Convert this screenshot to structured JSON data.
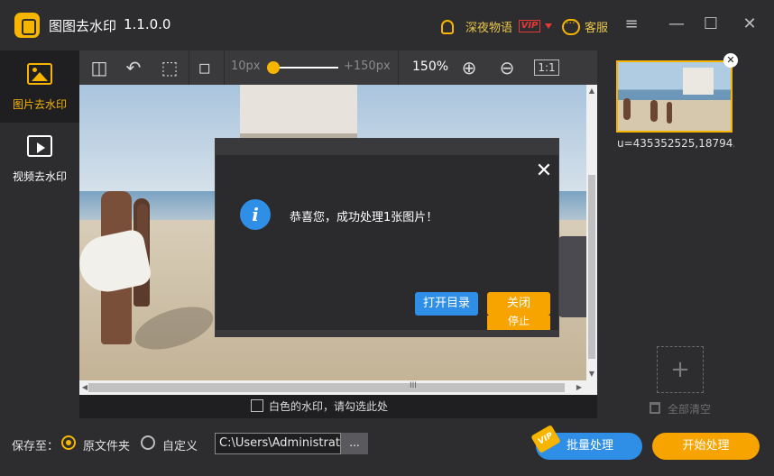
{
  "titlebar": {
    "app_name": "图图去水印",
    "version": "1.1.0.0",
    "user_name": "深夜物语",
    "vip_badge": "VIP",
    "service_label": "客服",
    "menu_icon": "≡",
    "minimize_icon": "—",
    "maximize_icon": "☐",
    "close_icon": "✕"
  },
  "sidebar": {
    "items": [
      {
        "label": "图片去水印",
        "icon": "image-icon",
        "active": true
      },
      {
        "label": "视频去水印",
        "icon": "video-icon",
        "active": false
      }
    ]
  },
  "toolbar": {
    "tools": [
      {
        "icon": "split-view-icon",
        "glyph": "◫"
      },
      {
        "icon": "undo-icon",
        "glyph": "↶"
      },
      {
        "icon": "select-rect-icon",
        "glyph": "⬚"
      },
      {
        "icon": "eraser-icon",
        "glyph": "◇"
      }
    ],
    "brush_min": "10px",
    "brush_max": "+150px",
    "brush_level": 0.0,
    "zoom_level": "150%",
    "zoom_in_glyph": "⊕",
    "zoom_out_glyph": "⊖",
    "actual_size_label": "1:1"
  },
  "canvas": {
    "white_watermark_label": "白色的水印，请勾选此处",
    "white_watermark_checked": false,
    "hscroll_grip": "III"
  },
  "file_list": {
    "items": [
      {
        "name": "u=435352525,18794...",
        "selected": true
      }
    ],
    "remove_glyph": "✕",
    "add_glyph": "+",
    "clear_all_label": "全部清空"
  },
  "bottom": {
    "save_to_label": "保存至：",
    "option_original": "原文件夹",
    "option_custom": "自定义",
    "selected_option": "原文件夹",
    "path_value": "C:\\Users\\Administrator",
    "browse_label": "...",
    "batch_label": "批量处理",
    "batch_vip": "VIP",
    "start_label": "开始处理"
  },
  "dialog": {
    "message": "恭喜您，成功处理1张图片！",
    "info_glyph": "i",
    "close_glyph": "✕",
    "open_dir_label": "打开目录",
    "close_label": "关闭",
    "behind_button_label": "停止"
  },
  "colors": {
    "accent": "#f7b500",
    "primary_blue": "#2f8fe6",
    "orange_button": "#f7a400",
    "panel_bg": "#2d2d30",
    "app_bg": "#1f1f21"
  }
}
